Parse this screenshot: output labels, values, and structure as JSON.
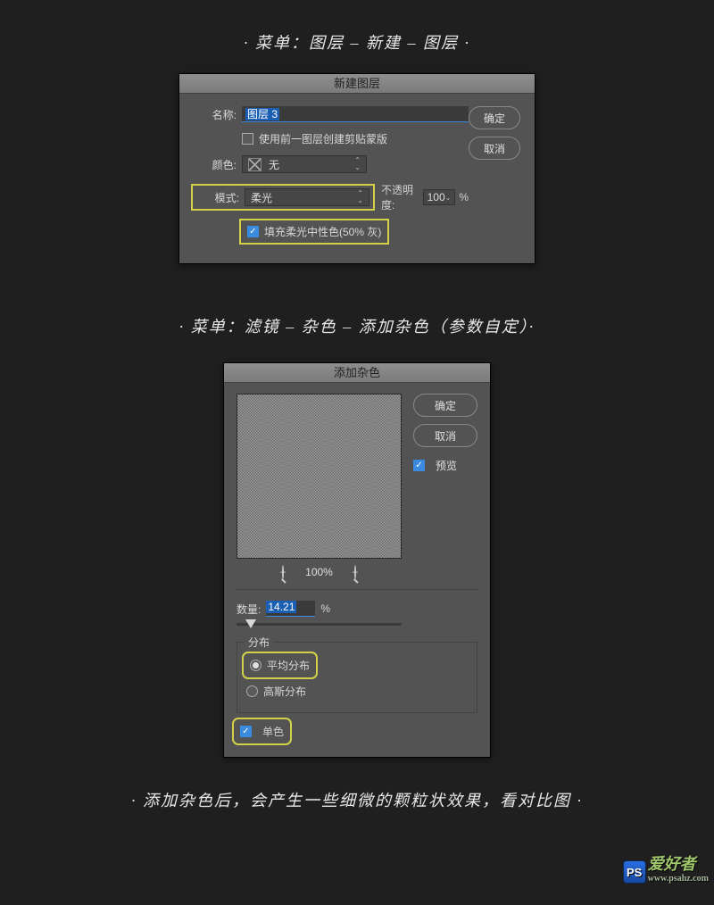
{
  "captions": {
    "c1": "· 菜单：图层 – 新建 – 图层 ·",
    "c2": "· 菜单：滤镜 – 杂色 – 添加杂色（参数自定）·",
    "c3": "· 添加杂色后，会产生一些细微的颗粒状效果，看对比图 ·"
  },
  "dlg1": {
    "title": "新建图层",
    "name_label": "名称:",
    "name_value": "图层 3",
    "clip_mask": "使用前一图层创建剪贴蒙版",
    "color_label": "颜色:",
    "color_value": "无",
    "mode_label": "模式:",
    "mode_value": "柔光",
    "opacity_label": "不透明度:",
    "opacity_value": "100",
    "opacity_unit": "%",
    "fill_neutral": "填充柔光中性色(50% 灰)",
    "ok": "确定",
    "cancel": "取消"
  },
  "dlg2": {
    "title": "添加杂色",
    "ok": "确定",
    "cancel": "取消",
    "preview": "预览",
    "zoom": "100%",
    "amount_label": "数量:",
    "amount_value": "14.21",
    "amount_unit": "%",
    "dist_group": "分布",
    "dist_uniform": "平均分布",
    "dist_gaussian": "高斯分布",
    "mono": "单色"
  },
  "wm": {
    "logo": "PS",
    "text": "爱好者",
    "url": "www.psahz.com"
  }
}
